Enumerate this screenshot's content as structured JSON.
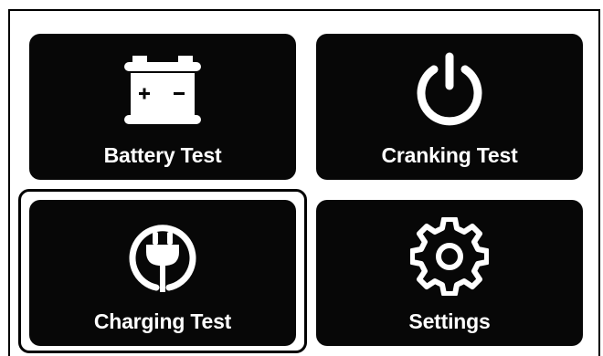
{
  "menu": {
    "items": [
      {
        "label": "Battery Test",
        "icon": "battery-icon"
      },
      {
        "label": "Cranking Test",
        "icon": "power-icon"
      },
      {
        "label": "Charging Test",
        "icon": "charging-plug-icon"
      },
      {
        "label": "Settings",
        "icon": "gear-icon"
      }
    ],
    "selected_index": 2
  },
  "colors": {
    "tile_background": "#070707",
    "tile_foreground": "#ffffff",
    "page_background": "#ffffff",
    "focus_ring": "#000000"
  }
}
